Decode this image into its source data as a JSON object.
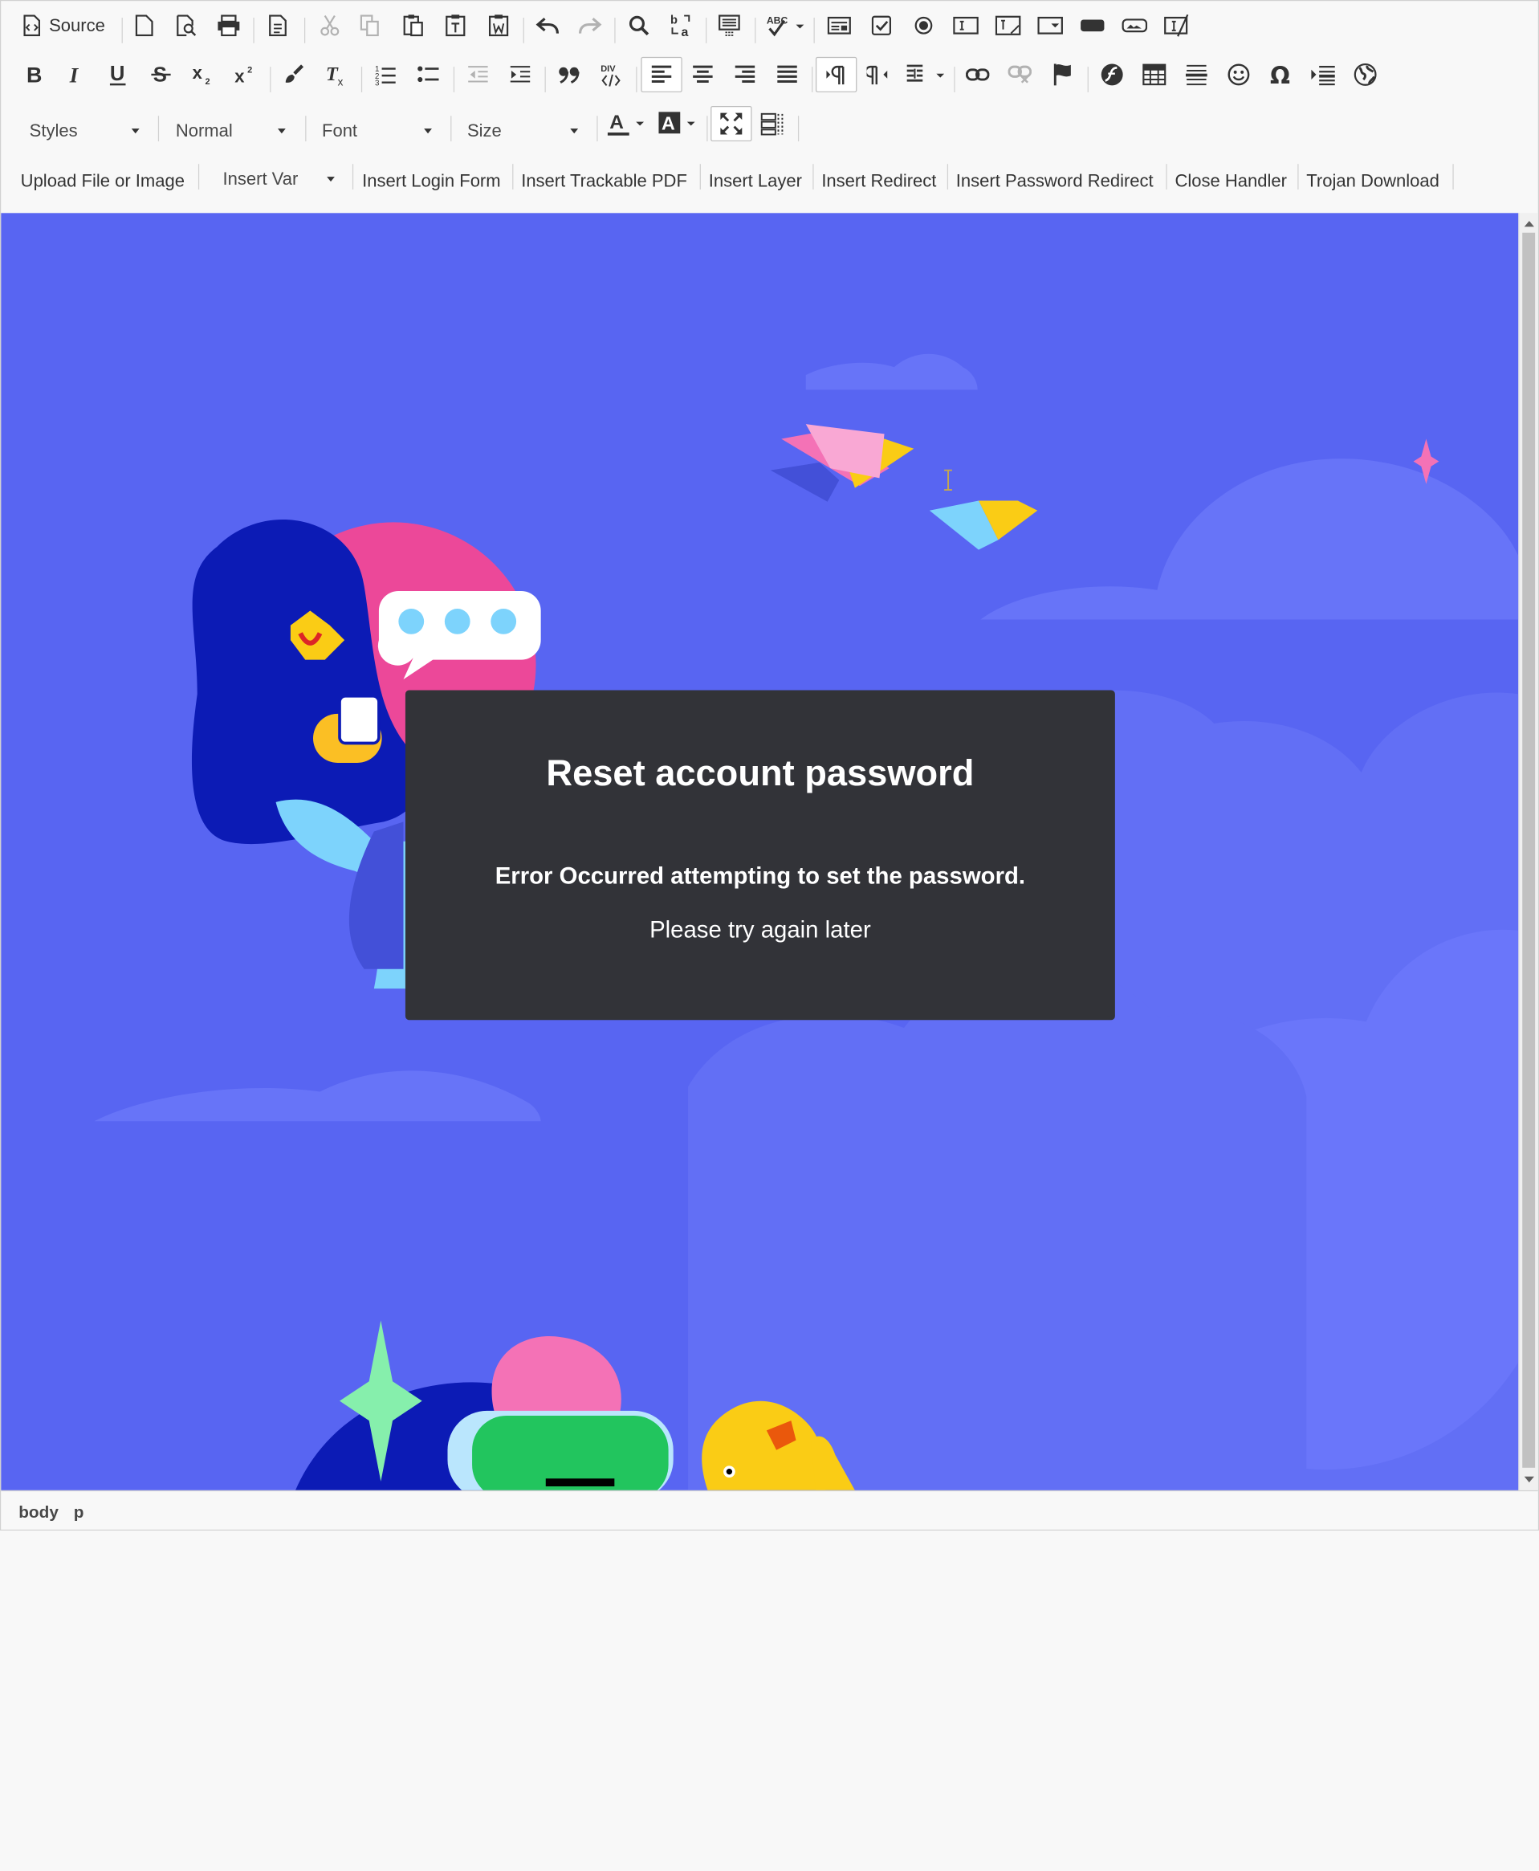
{
  "toolbar": {
    "source_label": "Source",
    "styles_label": "Styles",
    "format_label": "Normal",
    "font_label": "Font",
    "size_label": "Size",
    "plugins": {
      "upload": "Upload File or Image",
      "insert_var": "Insert Var",
      "login_form": "Insert Login Form",
      "trackable_pdf": "Insert Trackable PDF",
      "layer": "Insert Layer",
      "redirect": "Insert Redirect",
      "password_redirect": "Insert Password Redirect",
      "close_handler": "Close Handler",
      "trojan_download": "Trojan Download"
    }
  },
  "page": {
    "title": "Reset account password",
    "error": "Error Occurred attempting to set the password.",
    "message": "Please try again later"
  },
  "statusbar": {
    "path": [
      "body",
      "p"
    ]
  },
  "colors": {
    "page_background": "#5865f2",
    "card_background": "#323338"
  }
}
